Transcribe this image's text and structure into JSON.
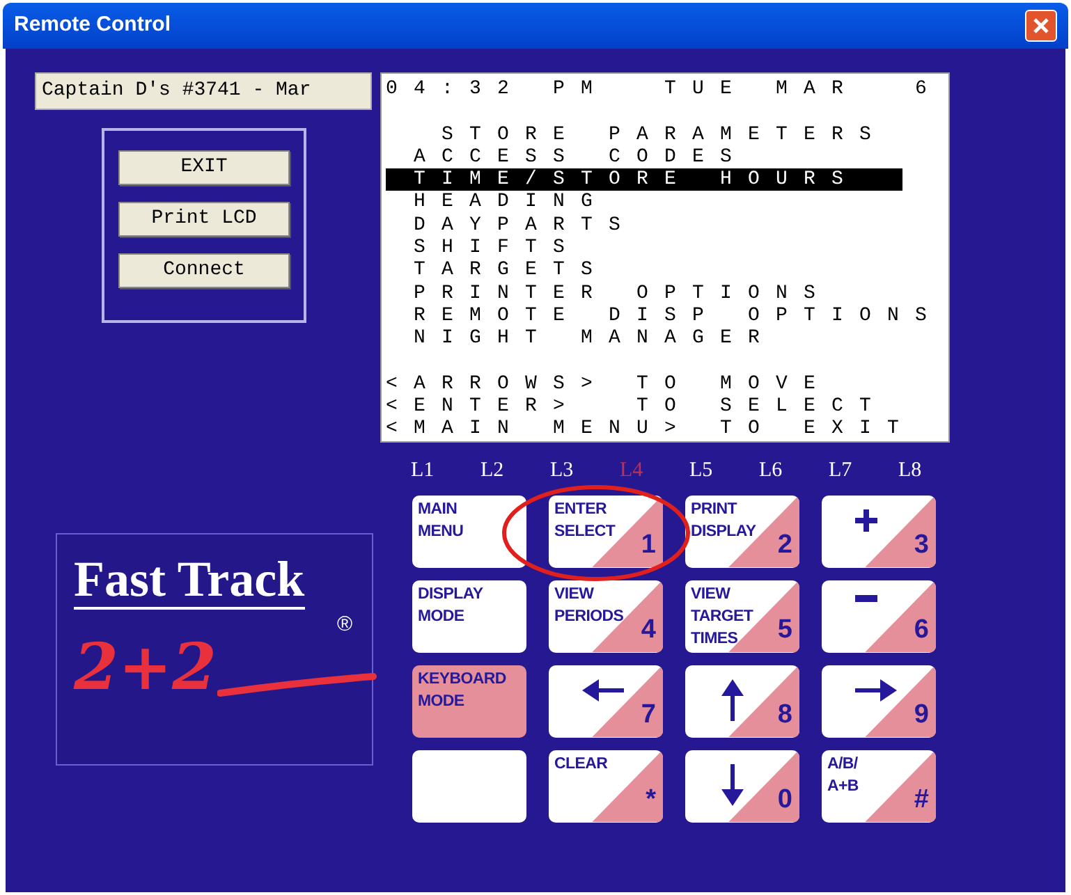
{
  "window": {
    "title": "Remote Control"
  },
  "store_field": {
    "value": "Captain D's #3741 - Mar"
  },
  "buttons": [
    "EXIT",
    "Print LCD",
    "Connect"
  ],
  "lcd": {
    "header": "04:32 PM  TUE MAR  6",
    "title": "STORE PARAMETERS",
    "items": [
      {
        "label": "ACCESS CODES",
        "selected": false
      },
      {
        "label": "TIME/STORE HOURS",
        "selected": true
      },
      {
        "label": "HEADING",
        "selected": false
      },
      {
        "label": "DAYPARTS",
        "selected": false
      },
      {
        "label": "SHIFTS",
        "selected": false
      },
      {
        "label": "TARGETS",
        "selected": false
      },
      {
        "label": "PRINTER OPTIONS",
        "selected": false
      },
      {
        "label": "REMOTE DISP OPTIONS",
        "selected": false
      },
      {
        "label": "NIGHT MANAGER",
        "selected": false
      }
    ],
    "hints": [
      "<ARROWS> TO MOVE",
      "<ENTER>  TO SELECT",
      "<MAIN MENU> TO EXIT"
    ]
  },
  "logo": {
    "name": "Fast Track",
    "mark": "®",
    "sub": "2+2"
  },
  "lamps": [
    "L1",
    "L2",
    "L3",
    "L4",
    "L5",
    "L6",
    "L7",
    "L8"
  ],
  "keys": [
    {
      "kind": "plain",
      "label": "MAIN\nMENU"
    },
    {
      "kind": "split",
      "label": "ENTER\nSELECT",
      "number": "1"
    },
    {
      "kind": "split",
      "label": "PRINT\nDISPLAY",
      "number": "2"
    },
    {
      "kind": "split",
      "number": "3"
    },
    {
      "kind": "plain",
      "label": "DISPLAY\nMODE"
    },
    {
      "kind": "split",
      "label": "VIEW\nPERIODS",
      "number": "4"
    },
    {
      "kind": "split",
      "label": "VIEW\nTARGET\nTIMES",
      "number": "5"
    },
    {
      "kind": "split",
      "number": "6"
    },
    {
      "kind": "filled",
      "label": "KEYBOARD\nMODE"
    },
    {
      "kind": "split",
      "number": "7"
    },
    {
      "kind": "split",
      "number": "8"
    },
    {
      "kind": "split",
      "number": "9"
    },
    {
      "kind": "plain"
    },
    {
      "kind": "split",
      "label": "CLEAR",
      "number": "*"
    },
    {
      "kind": "split",
      "number": "0"
    },
    {
      "kind": "split",
      "label": "A/B/\nA+B",
      "number": "#"
    }
  ]
}
